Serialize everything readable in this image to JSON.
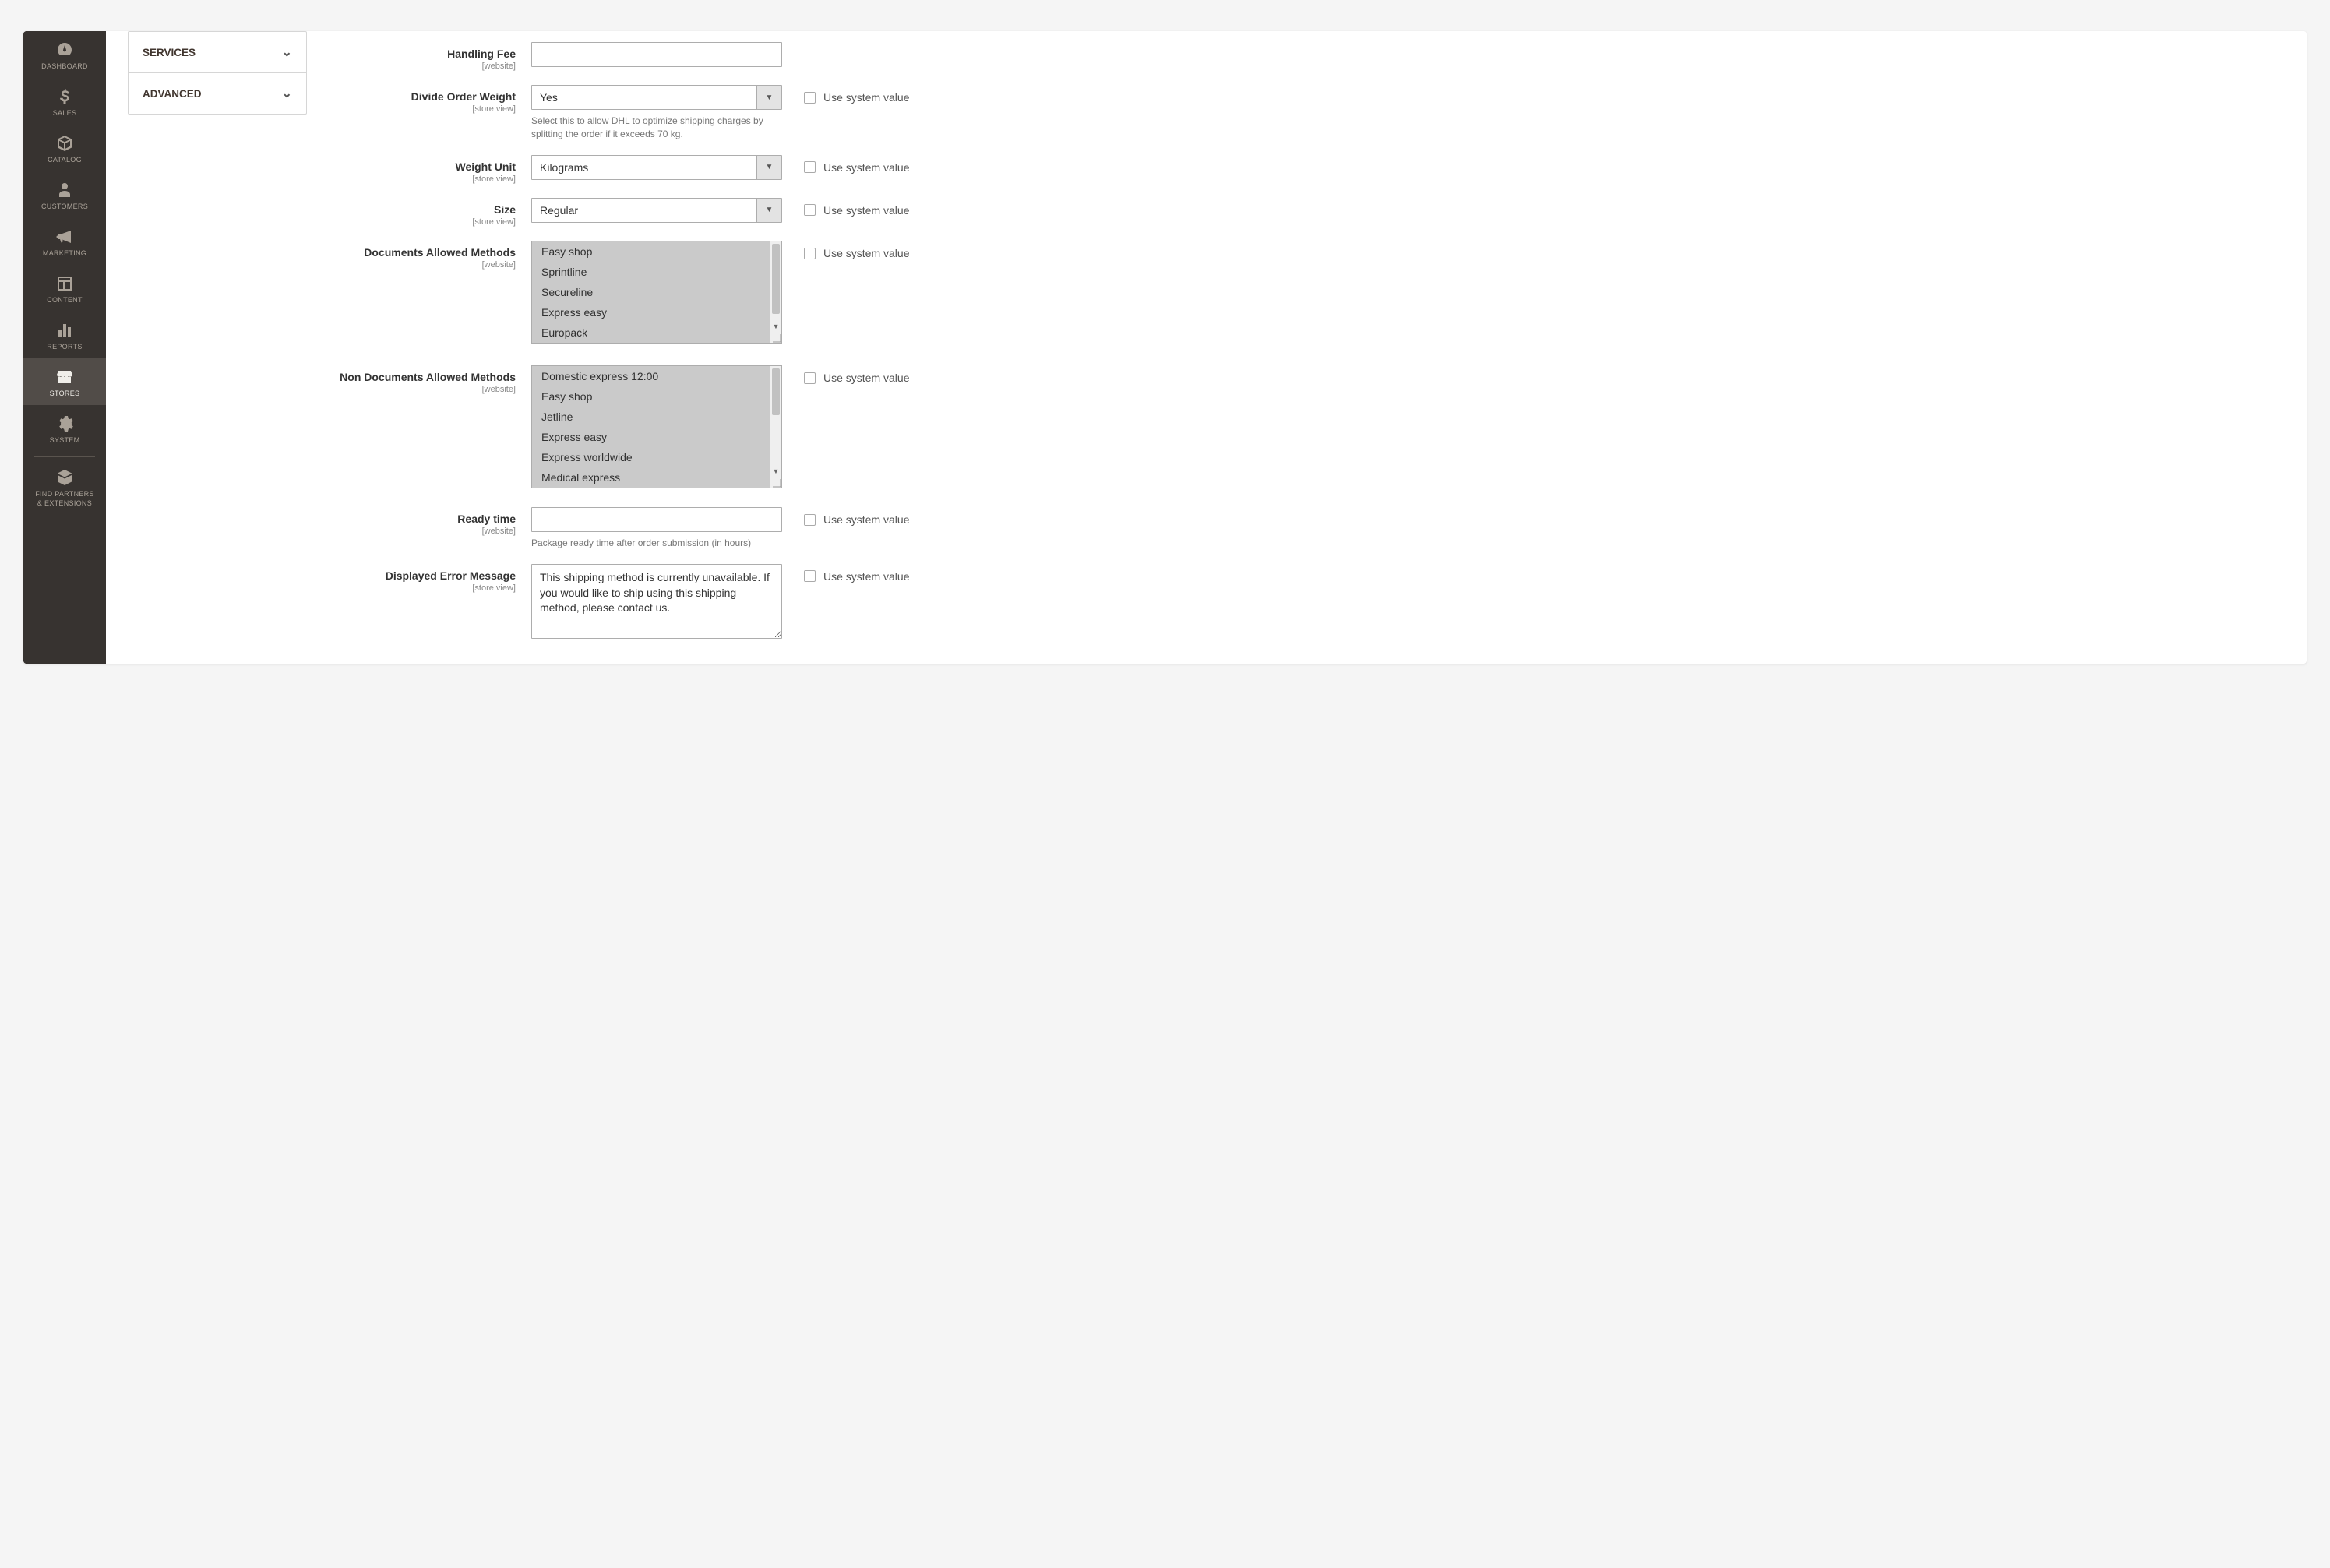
{
  "sidebar": {
    "items": [
      {
        "id": "dashboard",
        "label": "DASHBOARD"
      },
      {
        "id": "sales",
        "label": "SALES"
      },
      {
        "id": "catalog",
        "label": "CATALOG"
      },
      {
        "id": "customers",
        "label": "CUSTOMERS"
      },
      {
        "id": "marketing",
        "label": "MARKETING"
      },
      {
        "id": "content",
        "label": "CONTENT"
      },
      {
        "id": "reports",
        "label": "REPORTS"
      },
      {
        "id": "stores",
        "label": "STORES"
      },
      {
        "id": "system",
        "label": "SYSTEM"
      },
      {
        "id": "partners",
        "label": "FIND PARTNERS\n& EXTENSIONS"
      }
    ]
  },
  "accordion": {
    "items": [
      {
        "label": "SERVICES"
      },
      {
        "label": "ADVANCED"
      }
    ]
  },
  "use_system_value_label": "Use system value",
  "fields": {
    "handling_fee": {
      "label": "Handling Fee",
      "scope": "[website]",
      "value": ""
    },
    "divide_order_weight": {
      "label": "Divide Order Weight",
      "scope": "[store view]",
      "value": "Yes",
      "help": "Select this to allow DHL to optimize shipping charges by splitting the order if it exceeds 70 kg."
    },
    "weight_unit": {
      "label": "Weight Unit",
      "scope": "[store view]",
      "value": "Kilograms"
    },
    "size": {
      "label": "Size",
      "scope": "[store view]",
      "value": "Regular"
    },
    "doc_methods": {
      "label": "Documents Allowed Methods",
      "scope": "[website]",
      "options": [
        "Easy shop",
        "Sprintline",
        "Secureline",
        "Express easy",
        "Europack"
      ]
    },
    "nondoc_methods": {
      "label": "Non Documents Allowed Methods",
      "scope": "[website]",
      "options": [
        "Domestic express 12:00",
        "Easy shop",
        "Jetline",
        "Express easy",
        "Express worldwide",
        "Medical express"
      ]
    },
    "ready_time": {
      "label": "Ready time",
      "scope": "[website]",
      "value": "",
      "help": "Package ready time after order submission (in hours)"
    },
    "error_message": {
      "label": "Displayed Error Message",
      "scope": "[store view]",
      "value": "This shipping method is currently unavailable. If you would like to ship using this shipping method, please contact us."
    }
  }
}
